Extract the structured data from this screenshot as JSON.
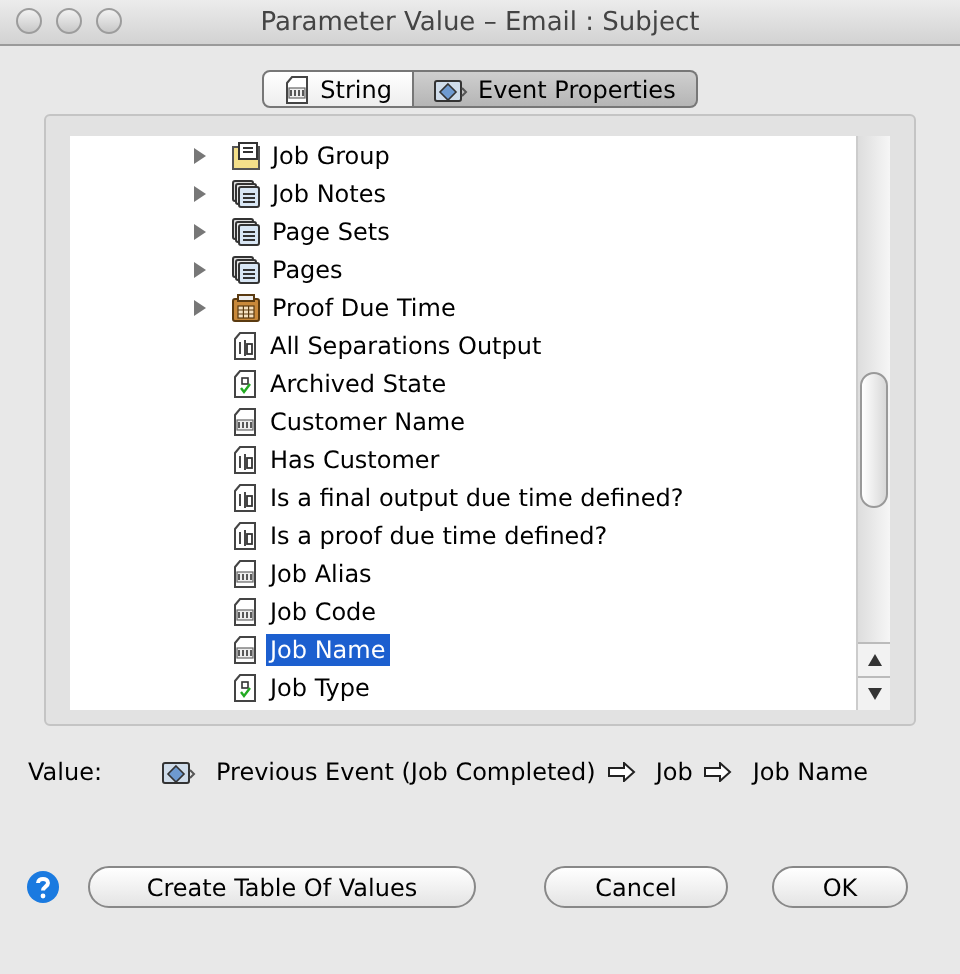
{
  "window": {
    "title": "Parameter Value – Email : Subject"
  },
  "tabs": [
    {
      "label": "String",
      "kind": "text",
      "selected": false
    },
    {
      "label": "Event Properties",
      "kind": "event",
      "selected": true
    }
  ],
  "tree": {
    "items": [
      {
        "label": "Job Group",
        "kind": "group",
        "expanded": false,
        "selected": false
      },
      {
        "label": "Job Notes",
        "kind": "list",
        "expanded": false,
        "selected": false
      },
      {
        "label": "Page Sets",
        "kind": "list",
        "expanded": false,
        "selected": false
      },
      {
        "label": "Pages",
        "kind": "list",
        "expanded": false,
        "selected": false
      },
      {
        "label": "Proof Due Time",
        "kind": "calendar",
        "expanded": false,
        "selected": false
      },
      {
        "label": "All Separations Output",
        "kind": "boolean",
        "selected": false
      },
      {
        "label": "Archived State",
        "kind": "state",
        "selected": false
      },
      {
        "label": "Customer Name",
        "kind": "text",
        "selected": false
      },
      {
        "label": "Has Customer",
        "kind": "boolean",
        "selected": false
      },
      {
        "label": "Is a final output due time defined?",
        "kind": "boolean",
        "selected": false
      },
      {
        "label": "Is a proof due time defined?",
        "kind": "boolean",
        "selected": false
      },
      {
        "label": "Job Alias",
        "kind": "text",
        "selected": false
      },
      {
        "label": "Job Code",
        "kind": "text",
        "selected": false
      },
      {
        "label": "Job Name",
        "kind": "text",
        "selected": true
      },
      {
        "label": "Job Type",
        "kind": "state",
        "selected": false
      }
    ]
  },
  "value": {
    "label": "Value:",
    "path": [
      "Previous Event (Job Completed)",
      "Job",
      "Job Name"
    ]
  },
  "buttons": [
    {
      "label": "Create Table Of Values",
      "kind": "action"
    },
    {
      "label": "Cancel",
      "kind": "cancel"
    },
    {
      "label": "OK",
      "kind": "ok"
    }
  ]
}
